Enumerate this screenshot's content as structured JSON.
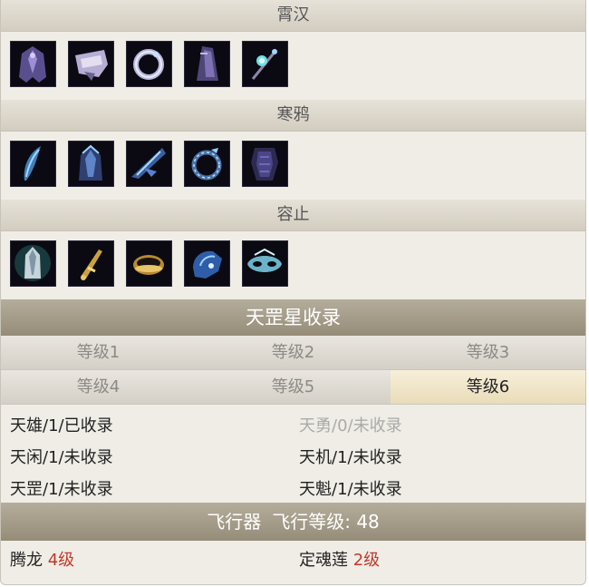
{
  "categories": [
    {
      "name": "霄汉",
      "items": [
        "robe-icon",
        "armband-icon",
        "bracelet-icon",
        "cloak-icon",
        "scepter-icon"
      ]
    },
    {
      "name": "寒鸦",
      "items": [
        "feather-icon",
        "spirit-robe-icon",
        "wing-blade-icon",
        "serpent-ring-icon",
        "dark-armor-icon"
      ]
    },
    {
      "name": "容止",
      "items": [
        "jade-robe-icon",
        "dagger-icon",
        "gold-ring-icon",
        "gauntlet-icon",
        "mask-icon"
      ]
    }
  ],
  "collection": {
    "title": "天罡星收录",
    "tabs": [
      "等级1",
      "等级2",
      "等级3",
      "等级4",
      "等级5",
      "等级6"
    ],
    "active_tab": "等级6",
    "rows": [
      [
        "天雄/1/已收录",
        "天勇/0/未收录"
      ],
      [
        "天闲/1/未收录",
        "天机/1/未收录"
      ],
      [
        "天罡/1/未收录",
        "天魁/1/未收录"
      ]
    ]
  },
  "craft": {
    "title": "飞行器",
    "level_label": "飞行等级: 48",
    "items": [
      {
        "name": "腾龙",
        "level": "4级"
      },
      {
        "name": "定魂莲",
        "level": "2级"
      }
    ]
  }
}
